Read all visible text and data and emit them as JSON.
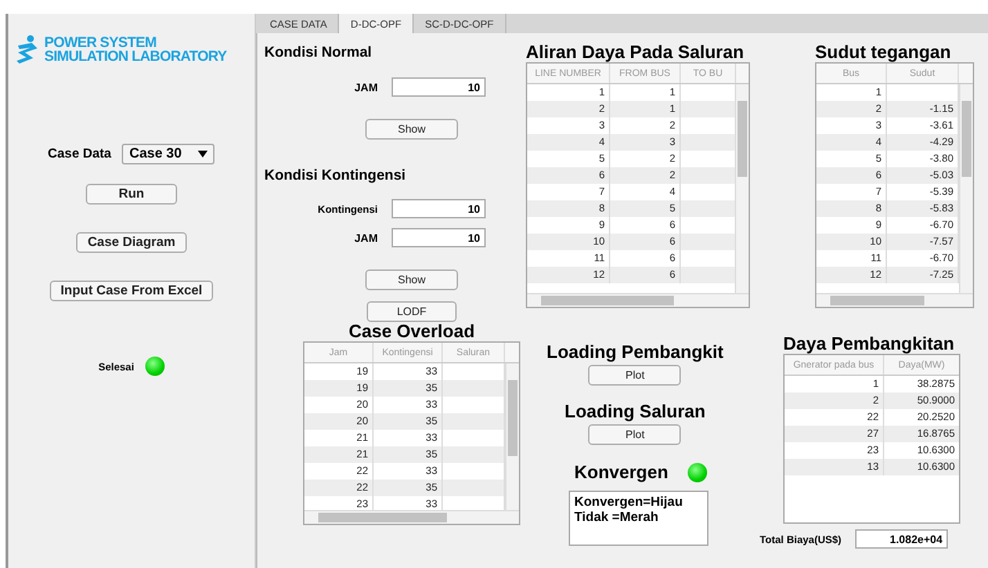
{
  "logo": {
    "line1": "POWER SYSTEM",
    "line2": "SIMULATION LABORATORY"
  },
  "left": {
    "case_label": "Case Data",
    "case_value": "Case 30",
    "buttons": [
      "Run",
      "Case Diagram",
      "Input Case From Excel"
    ],
    "status_label": "Selesai",
    "status_on": true
  },
  "tabs": [
    {
      "label": "CASE DATA",
      "selected": false
    },
    {
      "label": "D-DC-OPF",
      "selected": true
    },
    {
      "label": "SC-D-DC-OPF",
      "selected": false
    }
  ],
  "normal": {
    "title": "Kondisi Normal",
    "jam_label": "JAM",
    "jam_value": "10",
    "button": "Show"
  },
  "kontingensi": {
    "title": "Kondisi Kontingensi",
    "k_label": "Kontingensi",
    "k_value": "10",
    "jam_label": "JAM",
    "jam_value": "10",
    "button": "Show",
    "lodf_button": "LODF"
  },
  "case_overload": {
    "title": "Case Overload",
    "columns": [
      "Jam",
      "Kontingensi",
      "Saluran"
    ],
    "rows": [
      [
        "19",
        "33",
        ""
      ],
      [
        "19",
        "35",
        ""
      ],
      [
        "20",
        "33",
        ""
      ],
      [
        "20",
        "35",
        ""
      ],
      [
        "21",
        "33",
        ""
      ],
      [
        "21",
        "35",
        ""
      ],
      [
        "22",
        "33",
        ""
      ],
      [
        "22",
        "35",
        ""
      ],
      [
        "23",
        "33",
        ""
      ]
    ]
  },
  "aliran": {
    "title": "Aliran Daya Pada Saluran",
    "columns": [
      "LINE NUMBER",
      "FROM BUS",
      "TO BU"
    ],
    "rows": [
      [
        "1",
        "1",
        ""
      ],
      [
        "2",
        "1",
        ""
      ],
      [
        "3",
        "2",
        ""
      ],
      [
        "4",
        "3",
        ""
      ],
      [
        "5",
        "2",
        ""
      ],
      [
        "6",
        "2",
        ""
      ],
      [
        "7",
        "4",
        ""
      ],
      [
        "8",
        "5",
        ""
      ],
      [
        "9",
        "6",
        ""
      ],
      [
        "10",
        "6",
        ""
      ],
      [
        "11",
        "6",
        ""
      ],
      [
        "12",
        "6",
        ""
      ]
    ]
  },
  "sudut": {
    "title": "Sudut tegangan",
    "columns": [
      "Bus",
      "Sudut"
    ],
    "rows": [
      [
        "1",
        ""
      ],
      [
        "2",
        "-1.15"
      ],
      [
        "3",
        "-3.61"
      ],
      [
        "4",
        "-4.29"
      ],
      [
        "5",
        "-3.80"
      ],
      [
        "6",
        "-5.03"
      ],
      [
        "7",
        "-5.39"
      ],
      [
        "8",
        "-5.83"
      ],
      [
        "9",
        "-6.70"
      ],
      [
        "10",
        "-7.57"
      ],
      [
        "11",
        "-6.70"
      ],
      [
        "12",
        "-7.25"
      ]
    ]
  },
  "loading_pembangkit": {
    "title": "Loading Pembangkit",
    "button": "Plot"
  },
  "loading_saluran": {
    "title": "Loading Saluran",
    "button": "Plot"
  },
  "konvergen": {
    "title": "Konvergen",
    "on": true,
    "legend": [
      "Konvergen=Hijau",
      "Tidak =Merah"
    ]
  },
  "daya": {
    "title": "Daya Pembangkitan",
    "columns": [
      "Gnerator pada bus",
      "Daya(MW)"
    ],
    "rows": [
      [
        "1",
        "38.2875"
      ],
      [
        "2",
        "50.9000"
      ],
      [
        "22",
        "20.2520"
      ],
      [
        "27",
        "16.8765"
      ],
      [
        "23",
        "10.6300"
      ],
      [
        "13",
        "10.6300"
      ]
    ],
    "total_label": "Total Biaya(US$)",
    "total_value": "1.082e+04"
  }
}
